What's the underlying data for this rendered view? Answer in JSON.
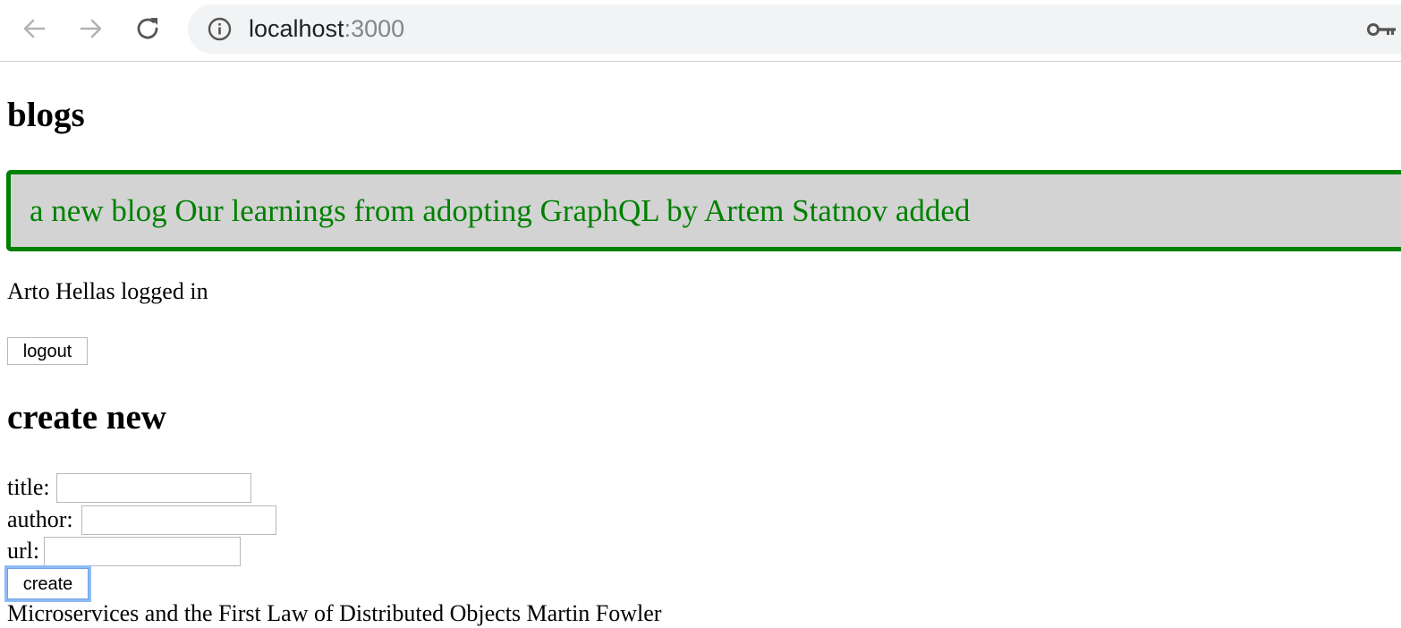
{
  "browser": {
    "url_host": "localhost",
    "url_port": ":3000",
    "icons": [
      "back-arrow-icon",
      "forward-arrow-icon",
      "reload-icon",
      "info-icon",
      "key-icon"
    ]
  },
  "page": {
    "heading": "blogs",
    "notification": {
      "message": "a new blog Our learnings from adopting GraphQL by Artem Statnov added",
      "text_color": "#008000",
      "border_color": "#008000",
      "background_color": "#d3d3d3"
    },
    "user_status": "Arto Hellas logged in",
    "logout_label": "logout",
    "create_heading": "create new",
    "form": {
      "title_label": "title:",
      "title_value": "",
      "author_label": "author:",
      "author_value": "",
      "url_label": "url:",
      "url_value": "",
      "create_label": "create"
    },
    "blogs": [
      "Microservices and the First Law of Distributed Objects Martin Fowler"
    ]
  }
}
